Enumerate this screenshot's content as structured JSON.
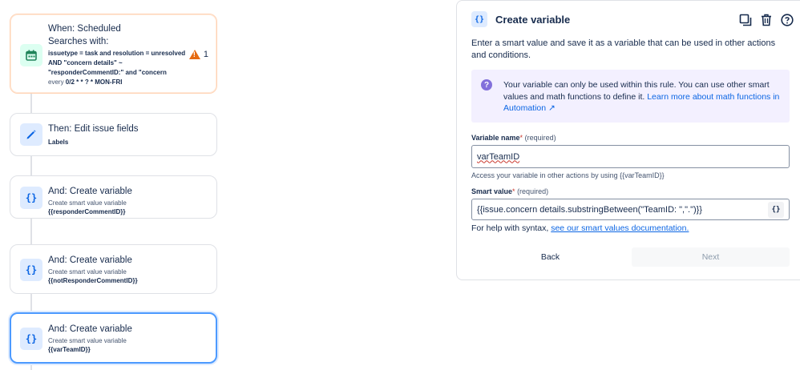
{
  "flow": {
    "trigger": {
      "title": "When: Scheduled",
      "searches_label": "Searches with:",
      "jql_line1": "issuetype = task and resolution = unresolved",
      "jql_line2": "AND \"concern details\" ~",
      "jql_line3": "\"responderCommentID:\" and \"concern",
      "schedule_prefix": "every",
      "schedule_value": "0/2 * * ? * MON-FRI",
      "warning_count": "1"
    },
    "steps": [
      {
        "title": "Then: Edit issue fields",
        "detail": "Labels"
      },
      {
        "title": "And: Create variable",
        "sub": "Create smart value variable",
        "detail": "{{responderCommentID}}"
      },
      {
        "title": "And: Create variable",
        "sub": "Create smart value variable",
        "detail": "{{notResponderCommentID}}"
      },
      {
        "title": "And: Create variable",
        "sub": "Create smart value variable",
        "detail": "{{varTeamID}}"
      }
    ],
    "icons": {
      "braces": "{}"
    }
  },
  "panel": {
    "title": "Create variable",
    "icon": "{}",
    "description": "Enter a smart value and save it as a variable that can be used in other actions and conditions.",
    "info_text": "Your variable can only be used within this rule. You can use other smart values and math functions to define it.",
    "info_link": "Learn more about math functions in Automation ↗",
    "variable_name_label": "Variable name",
    "smart_value_label": "Smart value",
    "required_mark": "*",
    "required_text": "(required)",
    "variable_name_value": "varTeamID",
    "variable_name_helper": "Access your variable in other actions by using {{varTeamID}}",
    "smart_value_value": "{{issue.concern details.substringBetween(\"TeamID: \",\".\")}}",
    "smart_value_button": "{}",
    "syntax_text": "For help with syntax,",
    "syntax_link": "see our smart values documentation.",
    "back_label": "Back",
    "next_label": "Next"
  },
  "colors": {
    "accent": "#0c66e4",
    "selected_border": "#4c9aff",
    "warning": "#e56910",
    "info_bg": "#f3f0ff"
  }
}
